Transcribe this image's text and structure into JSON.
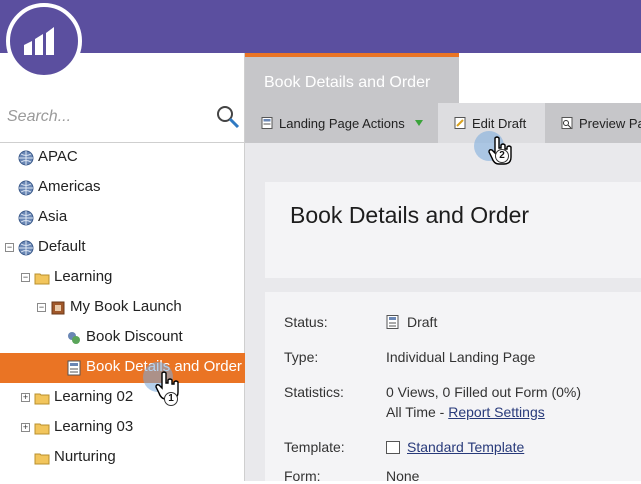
{
  "colors": {
    "header": "#5b4f9f",
    "accent": "#ea7424",
    "panel": "#e9e9ec"
  },
  "search": {
    "placeholder": "Search..."
  },
  "tree": [
    {
      "label": "APAC",
      "icon": "globe-icon"
    },
    {
      "label": "Americas",
      "icon": "globe-icon"
    },
    {
      "label": "Asia",
      "icon": "globe-icon"
    },
    {
      "label": "Default",
      "icon": "globe-icon"
    },
    {
      "label": "Learning",
      "icon": "folder-icon"
    },
    {
      "label": "My Book Launch",
      "icon": "program-icon"
    },
    {
      "label": "Book Discount",
      "icon": "email-campaign-icon"
    },
    {
      "label": "Book Details and Order",
      "icon": "landing-page-icon"
    },
    {
      "label": "Learning 02",
      "icon": "folder-icon"
    },
    {
      "label": "Learning 03",
      "icon": "folder-icon"
    },
    {
      "label": "Nurturing",
      "icon": "folder-icon"
    }
  ],
  "tab": {
    "title": "Book Details and Order"
  },
  "toolbar": {
    "actions": "Landing Page Actions",
    "edit_draft": "Edit Draft",
    "preview": "Preview Pa"
  },
  "page": {
    "title": "Book Details and Order",
    "status_label": "Status:",
    "status_value": "Draft",
    "type_label": "Type:",
    "type_value": "Individual Landing Page",
    "stats_label": "Statistics:",
    "stats_value": "0 Views, 0 Filled out Form (0%)",
    "stats_range": "All Time -",
    "report_settings": "Report Settings",
    "template_label": "Template:",
    "template_value": "Standard Template",
    "form_label": "Form:",
    "form_value": "None"
  },
  "markers": {
    "first": "1",
    "second": "2"
  }
}
